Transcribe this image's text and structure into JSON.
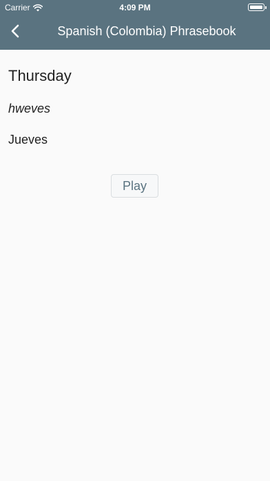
{
  "status_bar": {
    "carrier": "Carrier",
    "time": "4:09 PM"
  },
  "nav": {
    "back_icon": "chevron-left-icon",
    "title": "Spanish (Colombia) Phrasebook"
  },
  "phrase": {
    "english": "Thursday",
    "pronunciation": "hweves",
    "translation": "Jueves"
  },
  "actions": {
    "play_label": "Play"
  },
  "colors": {
    "header_background": "#5a7380",
    "page_background": "#fafafa",
    "accent": "#5a7380"
  }
}
